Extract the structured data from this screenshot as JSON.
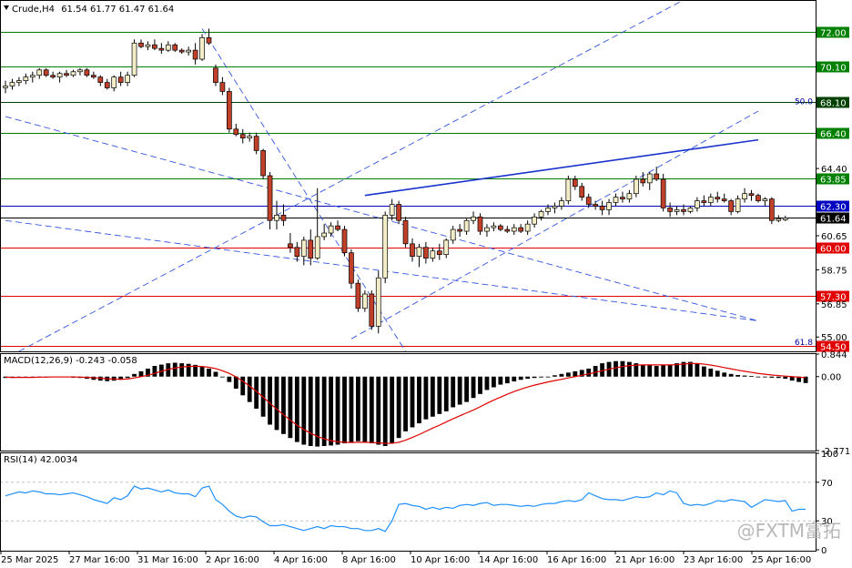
{
  "header": {
    "symbol_label": "Crude,H4",
    "ohlc": "61.54 61.77 61.47 61.64"
  },
  "watermark": "@FXTM富拓",
  "price_axis": {
    "plain_ticks": [
      "64.40",
      "60.65",
      "58.75",
      "56.85",
      "55.00"
    ],
    "fib_labels": [
      {
        "text": "50.0",
        "price": 68.2
      },
      {
        "text": "61.8",
        "price": 54.75
      }
    ]
  },
  "levels": [
    {
      "value": 72.0,
      "label": "72.00",
      "color": "#008000"
    },
    {
      "value": 70.1,
      "label": "70.10",
      "color": "#008000"
    },
    {
      "value": 68.1,
      "label": "68.10",
      "color": "#004000"
    },
    {
      "value": 66.4,
      "label": "66.40",
      "color": "#008000"
    },
    {
      "value": 63.85,
      "label": "63.85",
      "color": "#008000"
    },
    {
      "value": 62.3,
      "label": "62.30",
      "color": "#0000c0"
    },
    {
      "value": 61.64,
      "label": "61.64",
      "color": "#000000"
    },
    {
      "value": 60.0,
      "label": "60.00",
      "color": "#e00000"
    },
    {
      "value": 57.3,
      "label": "57.30",
      "color": "#e00000"
    },
    {
      "value": 54.5,
      "label": "54.50",
      "color": "#e00000"
    }
  ],
  "macd": {
    "label": "MACD(12,26,9) -0.243 -0.058",
    "ticks": [
      "0.844",
      "0.00",
      "-2.771"
    ],
    "range": [
      -2.771,
      0.844
    ]
  },
  "rsi": {
    "label": "RSI(14) 42.0034",
    "ticks": [
      "100",
      "70",
      "30",
      "0"
    ],
    "range": [
      0,
      100
    ],
    "levels": [
      70,
      30
    ]
  },
  "time_axis": [
    "25 Mar 2025",
    "27 Mar 16:00",
    "31 Mar 16:00",
    "2 Apr 16:00",
    "4 Apr 16:00",
    "8 Apr 16:00",
    "10 Apr 16:00",
    "14 Apr 16:00",
    "16 Apr 16:00",
    "21 Apr 16:00",
    "23 Apr 16:00",
    "25 Apr 16:00"
  ],
  "chart_data": {
    "type": "candlestick",
    "title": "",
    "xlabel": "",
    "ylabel": "",
    "ylim": [
      54.2,
      73.8
    ],
    "trendlines": [
      {
        "style": "dashed",
        "points": [
          [
            0,
            67.3
          ],
          [
            111,
            55.9
          ]
        ]
      },
      {
        "style": "dashed",
        "points": [
          [
            0,
            61.5
          ],
          [
            111,
            55.9
          ]
        ]
      },
      {
        "style": "dashed",
        "points": [
          [
            2,
            54.2
          ],
          [
            101,
            74.0
          ]
        ]
      },
      {
        "style": "dashed",
        "points": [
          [
            51,
            54.9
          ],
          [
            111,
            67.6
          ]
        ]
      },
      {
        "style": "dashed",
        "points": [
          [
            29,
            72.2
          ],
          [
            59,
            54.2
          ]
        ]
      },
      {
        "style": "solid",
        "points": [
          [
            53,
            62.9
          ],
          [
            111,
            66.0
          ]
        ]
      }
    ],
    "candles": [
      {
        "o": 68.9,
        "h": 69.3,
        "l": 68.6,
        "c": 69.0
      },
      {
        "o": 69.0,
        "h": 69.4,
        "l": 68.8,
        "c": 69.2
      },
      {
        "o": 69.2,
        "h": 69.5,
        "l": 69.0,
        "c": 69.3
      },
      {
        "o": 69.3,
        "h": 69.7,
        "l": 69.1,
        "c": 69.5
      },
      {
        "o": 69.5,
        "h": 69.8,
        "l": 69.2,
        "c": 69.6
      },
      {
        "o": 69.6,
        "h": 70.0,
        "l": 69.4,
        "c": 69.9
      },
      {
        "o": 69.9,
        "h": 70.0,
        "l": 69.5,
        "c": 69.6
      },
      {
        "o": 69.6,
        "h": 69.8,
        "l": 69.4,
        "c": 69.5
      },
      {
        "o": 69.5,
        "h": 69.8,
        "l": 69.2,
        "c": 69.7
      },
      {
        "o": 69.7,
        "h": 69.9,
        "l": 69.5,
        "c": 69.6
      },
      {
        "o": 69.6,
        "h": 69.9,
        "l": 69.5,
        "c": 69.8
      },
      {
        "o": 69.8,
        "h": 70.0,
        "l": 69.6,
        "c": 69.9
      },
      {
        "o": 69.9,
        "h": 70.0,
        "l": 69.5,
        "c": 69.6
      },
      {
        "o": 69.6,
        "h": 69.8,
        "l": 69.4,
        "c": 69.5
      },
      {
        "o": 69.5,
        "h": 69.6,
        "l": 69.0,
        "c": 69.2
      },
      {
        "o": 69.2,
        "h": 69.4,
        "l": 68.8,
        "c": 68.9
      },
      {
        "o": 68.9,
        "h": 69.6,
        "l": 68.7,
        "c": 69.5
      },
      {
        "o": 69.5,
        "h": 69.8,
        "l": 69.0,
        "c": 69.2
      },
      {
        "o": 69.2,
        "h": 69.8,
        "l": 69.0,
        "c": 69.6
      },
      {
        "o": 69.6,
        "h": 71.6,
        "l": 69.5,
        "c": 71.4
      },
      {
        "o": 71.4,
        "h": 71.6,
        "l": 71.1,
        "c": 71.2
      },
      {
        "o": 71.2,
        "h": 71.5,
        "l": 71.0,
        "c": 71.3
      },
      {
        "o": 71.3,
        "h": 71.6,
        "l": 71.0,
        "c": 71.1
      },
      {
        "o": 71.1,
        "h": 71.4,
        "l": 70.8,
        "c": 71.0
      },
      {
        "o": 71.0,
        "h": 71.5,
        "l": 70.9,
        "c": 71.3
      },
      {
        "o": 71.3,
        "h": 71.4,
        "l": 70.9,
        "c": 71.0
      },
      {
        "o": 71.0,
        "h": 71.1,
        "l": 70.8,
        "c": 70.9
      },
      {
        "o": 70.9,
        "h": 71.2,
        "l": 70.7,
        "c": 71.0
      },
      {
        "o": 71.0,
        "h": 71.4,
        "l": 70.2,
        "c": 70.5
      },
      {
        "o": 70.5,
        "h": 71.9,
        "l": 70.4,
        "c": 71.7
      },
      {
        "o": 71.7,
        "h": 72.2,
        "l": 71.3,
        "c": 71.4
      },
      {
        "o": 70.0,
        "h": 70.2,
        "l": 69.0,
        "c": 69.2
      },
      {
        "o": 69.2,
        "h": 69.5,
        "l": 68.5,
        "c": 68.7
      },
      {
        "o": 68.7,
        "h": 68.9,
        "l": 66.4,
        "c": 66.6
      },
      {
        "o": 66.6,
        "h": 66.9,
        "l": 66.2,
        "c": 66.3
      },
      {
        "o": 66.3,
        "h": 66.6,
        "l": 65.8,
        "c": 66.1
      },
      {
        "o": 66.1,
        "h": 66.4,
        "l": 65.9,
        "c": 66.2
      },
      {
        "o": 66.2,
        "h": 66.4,
        "l": 65.2,
        "c": 65.4
      },
      {
        "o": 65.4,
        "h": 65.5,
        "l": 63.8,
        "c": 64.0
      },
      {
        "o": 64.0,
        "h": 64.2,
        "l": 61.0,
        "c": 61.5
      },
      {
        "o": 61.5,
        "h": 62.6,
        "l": 61.0,
        "c": 61.8
      },
      {
        "o": 61.8,
        "h": 62.4,
        "l": 61.2,
        "c": 61.5
      },
      {
        "o": 60.2,
        "h": 60.8,
        "l": 59.7,
        "c": 60.0
      },
      {
        "o": 60.0,
        "h": 60.3,
        "l": 59.2,
        "c": 59.5
      },
      {
        "o": 59.5,
        "h": 60.6,
        "l": 59.0,
        "c": 60.4
      },
      {
        "o": 60.4,
        "h": 61.0,
        "l": 59.0,
        "c": 59.4
      },
      {
        "o": 59.4,
        "h": 63.3,
        "l": 59.3,
        "c": 60.6
      },
      {
        "o": 60.6,
        "h": 61.3,
        "l": 60.4,
        "c": 60.8
      },
      {
        "o": 60.8,
        "h": 61.4,
        "l": 60.6,
        "c": 61.2
      },
      {
        "o": 61.2,
        "h": 61.5,
        "l": 60.9,
        "c": 61.0
      },
      {
        "o": 61.0,
        "h": 61.2,
        "l": 59.5,
        "c": 59.7
      },
      {
        "o": 59.7,
        "h": 59.9,
        "l": 57.7,
        "c": 58.0
      },
      {
        "o": 58.0,
        "h": 58.2,
        "l": 56.4,
        "c": 56.6
      },
      {
        "o": 56.6,
        "h": 57.6,
        "l": 56.4,
        "c": 57.4
      },
      {
        "o": 57.4,
        "h": 57.6,
        "l": 55.4,
        "c": 55.6
      },
      {
        "o": 55.6,
        "h": 58.7,
        "l": 55.2,
        "c": 58.3
      },
      {
        "o": 58.3,
        "h": 62.0,
        "l": 58.0,
        "c": 61.8
      },
      {
        "o": 61.8,
        "h": 62.7,
        "l": 61.5,
        "c": 62.4
      },
      {
        "o": 62.4,
        "h": 62.6,
        "l": 61.3,
        "c": 61.5
      },
      {
        "o": 61.5,
        "h": 61.7,
        "l": 60.0,
        "c": 60.2
      },
      {
        "o": 60.2,
        "h": 60.5,
        "l": 59.2,
        "c": 59.5
      },
      {
        "o": 59.5,
        "h": 60.2,
        "l": 58.9,
        "c": 60.0
      },
      {
        "o": 60.0,
        "h": 60.3,
        "l": 59.1,
        "c": 59.4
      },
      {
        "o": 59.4,
        "h": 60.0,
        "l": 59.2,
        "c": 59.8
      },
      {
        "o": 59.8,
        "h": 60.2,
        "l": 59.3,
        "c": 59.6
      },
      {
        "o": 59.6,
        "h": 60.5,
        "l": 59.4,
        "c": 60.4
      },
      {
        "o": 60.4,
        "h": 61.2,
        "l": 60.2,
        "c": 61.0
      },
      {
        "o": 61.0,
        "h": 61.3,
        "l": 60.6,
        "c": 60.9
      },
      {
        "o": 60.9,
        "h": 61.6,
        "l": 60.7,
        "c": 61.5
      },
      {
        "o": 61.5,
        "h": 62.0,
        "l": 61.3,
        "c": 61.7
      },
      {
        "o": 61.7,
        "h": 61.9,
        "l": 60.7,
        "c": 60.9
      },
      {
        "o": 60.9,
        "h": 61.3,
        "l": 60.6,
        "c": 61.1
      },
      {
        "o": 61.1,
        "h": 61.4,
        "l": 60.9,
        "c": 61.2
      },
      {
        "o": 61.2,
        "h": 61.3,
        "l": 60.9,
        "c": 61.0
      },
      {
        "o": 61.0,
        "h": 61.2,
        "l": 60.8,
        "c": 60.9
      },
      {
        "o": 60.9,
        "h": 61.3,
        "l": 60.7,
        "c": 61.1
      },
      {
        "o": 61.1,
        "h": 61.3,
        "l": 60.8,
        "c": 60.9
      },
      {
        "o": 60.9,
        "h": 61.5,
        "l": 60.7,
        "c": 61.3
      },
      {
        "o": 61.3,
        "h": 61.9,
        "l": 61.1,
        "c": 61.7
      },
      {
        "o": 61.7,
        "h": 62.1,
        "l": 61.5,
        "c": 62.0
      },
      {
        "o": 62.0,
        "h": 62.4,
        "l": 61.8,
        "c": 62.2
      },
      {
        "o": 62.2,
        "h": 62.5,
        "l": 61.9,
        "c": 62.3
      },
      {
        "o": 62.3,
        "h": 62.8,
        "l": 62.1,
        "c": 62.6
      },
      {
        "o": 62.6,
        "h": 64.0,
        "l": 62.4,
        "c": 63.8
      },
      {
        "o": 63.8,
        "h": 64.0,
        "l": 63.2,
        "c": 63.4
      },
      {
        "o": 63.4,
        "h": 63.6,
        "l": 62.6,
        "c": 62.8
      },
      {
        "o": 62.8,
        "h": 63.0,
        "l": 62.2,
        "c": 62.4
      },
      {
        "o": 62.4,
        "h": 62.6,
        "l": 62.1,
        "c": 62.3
      },
      {
        "o": 62.3,
        "h": 62.6,
        "l": 61.8,
        "c": 62.1
      },
      {
        "o": 62.1,
        "h": 62.7,
        "l": 61.8,
        "c": 62.5
      },
      {
        "o": 62.5,
        "h": 63.0,
        "l": 62.3,
        "c": 62.8
      },
      {
        "o": 62.8,
        "h": 63.1,
        "l": 62.5,
        "c": 62.7
      },
      {
        "o": 62.7,
        "h": 63.2,
        "l": 62.5,
        "c": 63.0
      },
      {
        "o": 63.0,
        "h": 64.0,
        "l": 62.8,
        "c": 63.8
      },
      {
        "o": 63.8,
        "h": 64.2,
        "l": 63.4,
        "c": 63.6
      },
      {
        "o": 63.6,
        "h": 64.2,
        "l": 63.2,
        "c": 64.1
      },
      {
        "o": 64.1,
        "h": 64.5,
        "l": 63.7,
        "c": 63.8
      },
      {
        "o": 63.8,
        "h": 64.1,
        "l": 62.0,
        "c": 62.2
      },
      {
        "o": 62.2,
        "h": 62.5,
        "l": 61.7,
        "c": 62.0
      },
      {
        "o": 62.0,
        "h": 62.3,
        "l": 61.8,
        "c": 62.1
      },
      {
        "o": 62.1,
        "h": 62.4,
        "l": 61.8,
        "c": 62.0
      },
      {
        "o": 62.0,
        "h": 62.3,
        "l": 61.9,
        "c": 62.2
      },
      {
        "o": 62.2,
        "h": 62.8,
        "l": 62.0,
        "c": 62.6
      },
      {
        "o": 62.6,
        "h": 62.9,
        "l": 62.3,
        "c": 62.5
      },
      {
        "o": 62.5,
        "h": 63.0,
        "l": 62.3,
        "c": 62.8
      },
      {
        "o": 62.8,
        "h": 63.1,
        "l": 62.5,
        "c": 62.7
      },
      {
        "o": 62.7,
        "h": 63.0,
        "l": 62.5,
        "c": 62.6
      },
      {
        "o": 62.6,
        "h": 62.7,
        "l": 61.8,
        "c": 62.0
      },
      {
        "o": 62.0,
        "h": 62.9,
        "l": 61.9,
        "c": 62.7
      },
      {
        "o": 62.7,
        "h": 63.3,
        "l": 62.5,
        "c": 63.0
      },
      {
        "o": 63.0,
        "h": 63.2,
        "l": 62.6,
        "c": 62.9
      },
      {
        "o": 62.9,
        "h": 63.0,
        "l": 62.5,
        "c": 62.6
      },
      {
        "o": 62.6,
        "h": 62.8,
        "l": 62.3,
        "c": 62.7
      },
      {
        "o": 62.7,
        "h": 62.8,
        "l": 61.3,
        "c": 61.5
      },
      {
        "o": 61.5,
        "h": 61.8,
        "l": 61.4,
        "c": 61.6
      },
      {
        "o": 61.54,
        "h": 61.77,
        "l": 61.47,
        "c": 61.64
      }
    ],
    "macd_histogram": [
      -0.05,
      -0.05,
      -0.04,
      -0.03,
      -0.02,
      -0.01,
      0.0,
      0.0,
      0.0,
      -0.02,
      -0.04,
      -0.05,
      -0.08,
      -0.12,
      -0.15,
      -0.17,
      -0.15,
      -0.12,
      -0.05,
      0.1,
      0.2,
      0.3,
      0.4,
      0.45,
      0.5,
      0.52,
      0.5,
      0.48,
      0.44,
      0.38,
      0.3,
      0.18,
      0.0,
      -0.2,
      -0.45,
      -0.7,
      -0.95,
      -1.2,
      -1.5,
      -1.8,
      -2.0,
      -2.15,
      -2.3,
      -2.45,
      -2.55,
      -2.6,
      -2.62,
      -2.6,
      -2.58,
      -2.55,
      -2.5,
      -2.45,
      -2.42,
      -2.45,
      -2.5,
      -2.55,
      -2.6,
      -2.5,
      -2.3,
      -2.05,
      -1.9,
      -1.75,
      -1.6,
      -1.5,
      -1.4,
      -1.3,
      -1.15,
      -1.05,
      -0.95,
      -0.8,
      -0.65,
      -0.5,
      -0.4,
      -0.3,
      -0.25,
      -0.18,
      -0.12,
      -0.08,
      -0.05,
      -0.03,
      0.0,
      0.05,
      0.1,
      0.15,
      0.2,
      0.25,
      0.3,
      0.4,
      0.5,
      0.55,
      0.58,
      0.58,
      0.55,
      0.5,
      0.45,
      0.42,
      0.4,
      0.42,
      0.45,
      0.5,
      0.55,
      0.55,
      0.48,
      0.38,
      0.3,
      0.22,
      0.15,
      0.1,
      0.06,
      0.04,
      0.02,
      0.0,
      -0.02,
      -0.04,
      -0.05,
      -0.08,
      -0.15,
      -0.2,
      -0.24
    ],
    "macd_signal": [
      -0.02,
      -0.03,
      -0.03,
      -0.03,
      -0.03,
      -0.02,
      -0.02,
      -0.01,
      -0.01,
      -0.01,
      -0.01,
      -0.02,
      -0.03,
      -0.04,
      -0.06,
      -0.08,
      -0.09,
      -0.1,
      -0.09,
      -0.05,
      0.0,
      0.05,
      0.12,
      0.2,
      0.27,
      0.32,
      0.36,
      0.38,
      0.39,
      0.38,
      0.35,
      0.3,
      0.22,
      0.12,
      -0.01,
      -0.17,
      -0.35,
      -0.55,
      -0.77,
      -1.0,
      -1.22,
      -1.43,
      -1.63,
      -1.82,
      -1.98,
      -2.12,
      -2.24,
      -2.33,
      -2.4,
      -2.44,
      -2.46,
      -2.47,
      -2.46,
      -2.46,
      -2.47,
      -2.48,
      -2.5,
      -2.5,
      -2.46,
      -2.38,
      -2.28,
      -2.17,
      -2.05,
      -1.93,
      -1.82,
      -1.7,
      -1.58,
      -1.47,
      -1.36,
      -1.25,
      -1.13,
      -1.0,
      -0.88,
      -0.77,
      -0.66,
      -0.56,
      -0.47,
      -0.39,
      -0.32,
      -0.26,
      -0.2,
      -0.15,
      -0.1,
      -0.05,
      0.0,
      0.05,
      0.1,
      0.16,
      0.22,
      0.28,
      0.33,
      0.38,
      0.41,
      0.43,
      0.44,
      0.44,
      0.44,
      0.44,
      0.44,
      0.45,
      0.47,
      0.49,
      0.49,
      0.47,
      0.43,
      0.39,
      0.34,
      0.29,
      0.24,
      0.2,
      0.16,
      0.12,
      0.09,
      0.06,
      0.04,
      0.02,
      0.0,
      -0.02,
      -0.04
    ],
    "rsi": [
      56,
      58,
      60,
      59,
      61,
      60,
      58,
      58,
      57,
      58,
      59,
      57,
      55,
      52,
      50,
      48,
      54,
      52,
      56,
      66,
      63,
      64,
      62,
      60,
      62,
      59,
      58,
      58,
      55,
      64,
      66,
      52,
      47,
      40,
      35,
      33,
      35,
      34,
      29,
      25,
      25,
      26,
      24,
      22,
      20,
      22,
      24,
      22,
      25,
      24,
      24,
      22,
      22,
      20,
      20,
      22,
      19,
      30,
      47,
      48,
      46,
      45,
      42,
      44,
      42,
      44,
      43,
      46,
      47,
      46,
      48,
      49,
      46,
      47,
      47,
      46,
      45,
      46,
      45,
      47,
      48,
      48,
      50,
      51,
      50,
      52,
      59,
      56,
      53,
      52,
      52,
      51,
      53,
      55,
      54,
      55,
      59,
      57,
      61,
      59,
      48,
      46,
      47,
      46,
      48,
      51,
      50,
      52,
      51,
      50,
      44,
      48,
      52,
      51,
      50,
      51,
      40,
      42,
      42
    ]
  }
}
